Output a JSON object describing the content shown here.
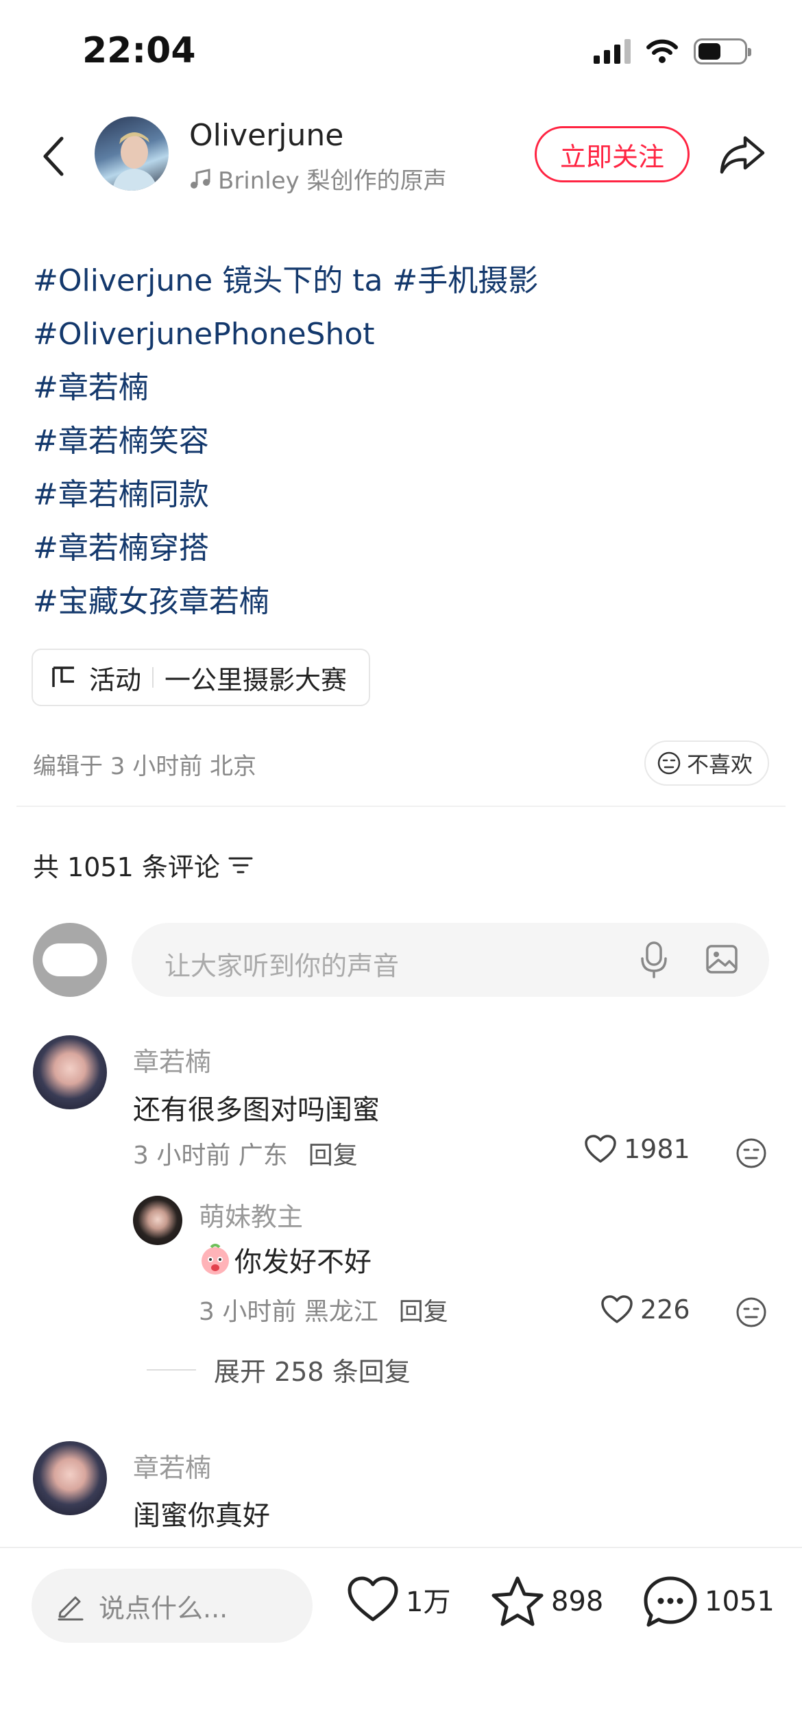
{
  "status_bar": {
    "time": "22:04",
    "battery_level": 0.5
  },
  "header": {
    "author_name": "Oliverjune",
    "music": "Brinley 梨创作的原声",
    "follow_label": "立即关注"
  },
  "tags": [
    "#Oliverjune 镜头下的 ta #手机摄影",
    "#OliverjunePhoneShot",
    "#章若楠",
    "#章若楠笑容",
    "#章若楠同款",
    "#章若楠穿搭",
    "#宝藏女孩章若楠"
  ],
  "activity": {
    "label": "活动",
    "name": "一公里摄影大赛"
  },
  "meta": {
    "edit_info": "编辑于 3 小时前 北京",
    "dislike_label": "不喜欢"
  },
  "comments_header": {
    "count_text": "共 1051 条评论"
  },
  "comment_input": {
    "placeholder": "让大家听到你的声音"
  },
  "comments": [
    {
      "user": "章若楠",
      "text": "还有很多图对吗闺蜜",
      "time_location": "3 小时前 广东",
      "reply_label": "回复",
      "likes": "1981"
    },
    {
      "user": "萌妹教主",
      "text": "你发好不好",
      "time_location": "3 小时前 黑龙江",
      "reply_label": "回复",
      "likes": "226"
    },
    {
      "user": "章若楠",
      "text": "闺蜜你真好"
    }
  ],
  "expand_replies": "展开 258 条回复",
  "bottom_bar": {
    "input_placeholder": "说点什么...",
    "likes": "1万",
    "favorites": "898",
    "comments": "1051"
  },
  "colors": {
    "accent": "#ff2442",
    "tag": "#13386c"
  }
}
